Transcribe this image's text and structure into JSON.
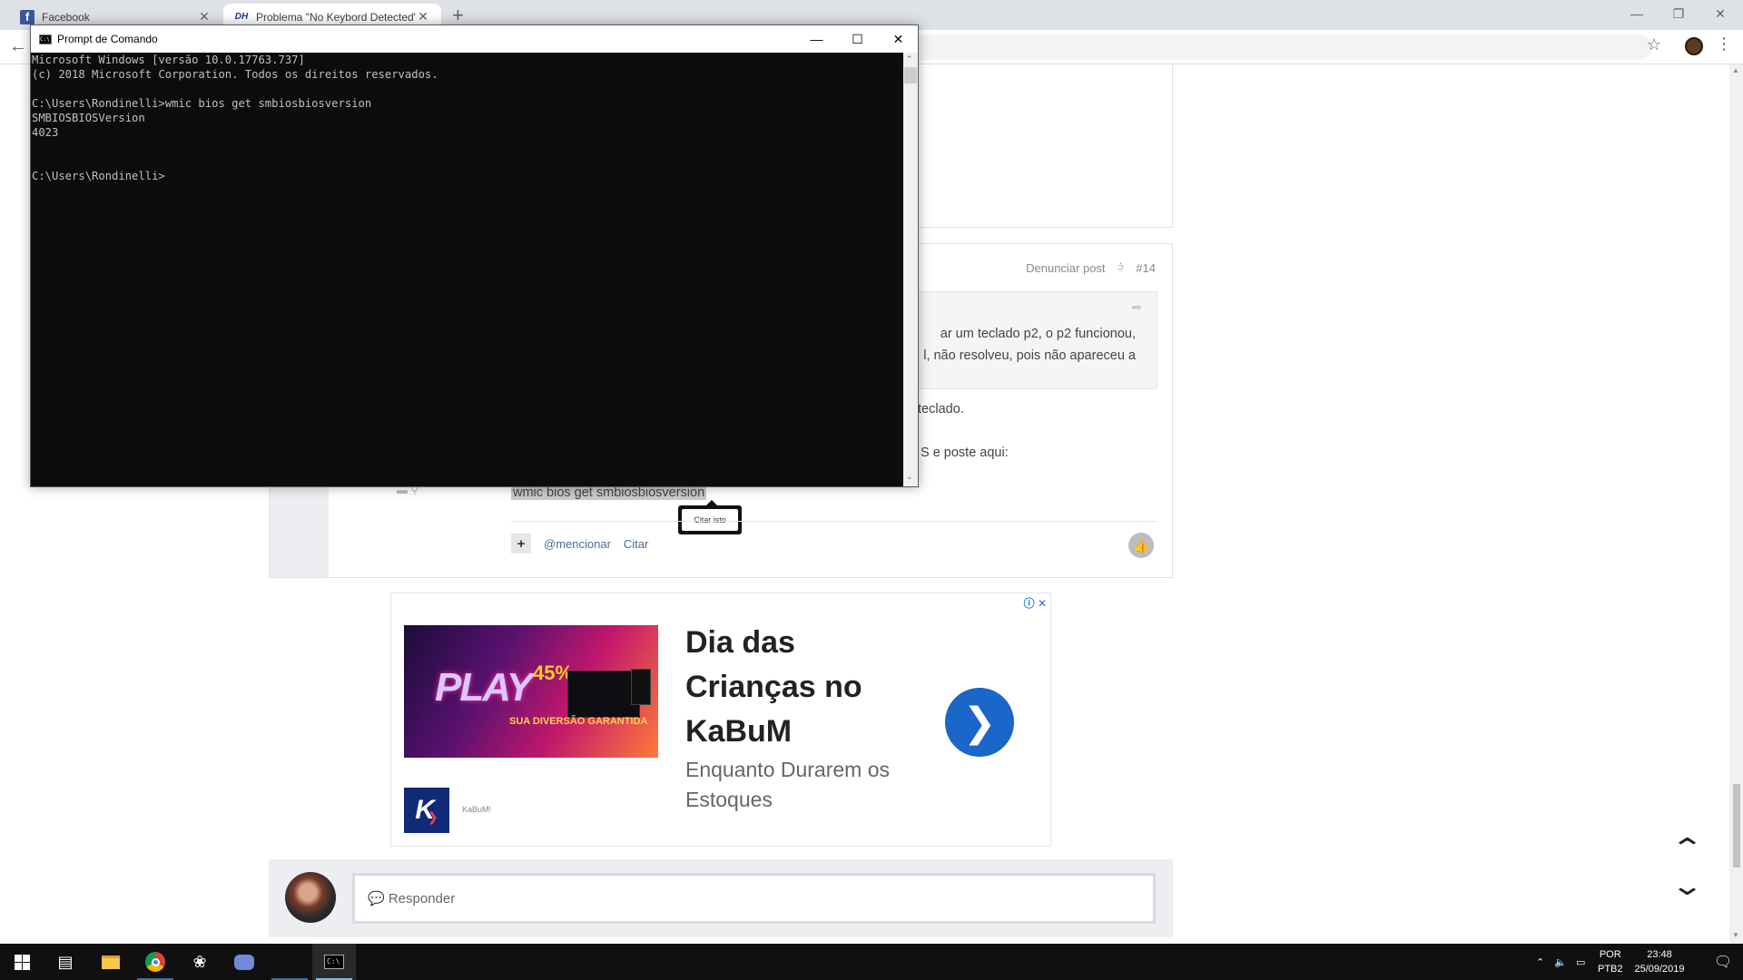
{
  "browser": {
    "tabs": [
      {
        "title": "Facebook",
        "favicon": "facebook-favicon-icon",
        "active": false
      },
      {
        "title": "Problema \"No Keybord Detected\"",
        "favicon": "dh-favicon-icon",
        "active": true
      }
    ],
    "tab_close_glyph": "✕",
    "new_tab_glyph": "+"
  },
  "post": {
    "report_link": "Denunciar post",
    "post_number": "#14",
    "quote_lines": [
      "ar um teclado p2, o p2 funcionou,",
      "l, não resolveu, pois não apareceu a"
    ],
    "body_lines": [
      "teclado.",
      "S e poste aqui:"
    ],
    "code": "wmic bios get smbiosbiosversion",
    "tooltip": "Citar isto",
    "actions": {
      "plus": "+",
      "mention": "@mencionar",
      "quote": "Citar"
    }
  },
  "ad": {
    "title": "Dia das Crianças no KaBuM",
    "subtitle": "Enquanto Durarem os Estoques",
    "brand": "KaBuM!",
    "image_text": {
      "main": "PLAY",
      "discount": "45%",
      "tagline": "SUA DIVERSÃO GARANTIDA"
    },
    "logo_letter": "K"
  },
  "reply": {
    "placeholder": "💬 Responder"
  },
  "cmd": {
    "title": "Prompt de Comando",
    "lines": [
      "Microsoft Windows [versão 10.0.17763.737]",
      "(c) 2018 Microsoft Corporation. Todos os direitos reservados.",
      "",
      "C:\\Users\\Rondinelli>wmic bios get smbiosbiosversion",
      "SMBIOSBIOSVersion",
      "4023",
      "",
      "",
      "C:\\Users\\Rondinelli>"
    ]
  },
  "taskbar": {
    "language": "POR",
    "keyboard": "PTB2",
    "time": "23:48",
    "date": "25/09/2019"
  },
  "colors": {
    "link": "#4a6d94",
    "ad_button": "#1a66c9",
    "taskbar": "#101010",
    "cmd_background": "#0c0c0c",
    "cmd_text": "#c0c0c0"
  }
}
